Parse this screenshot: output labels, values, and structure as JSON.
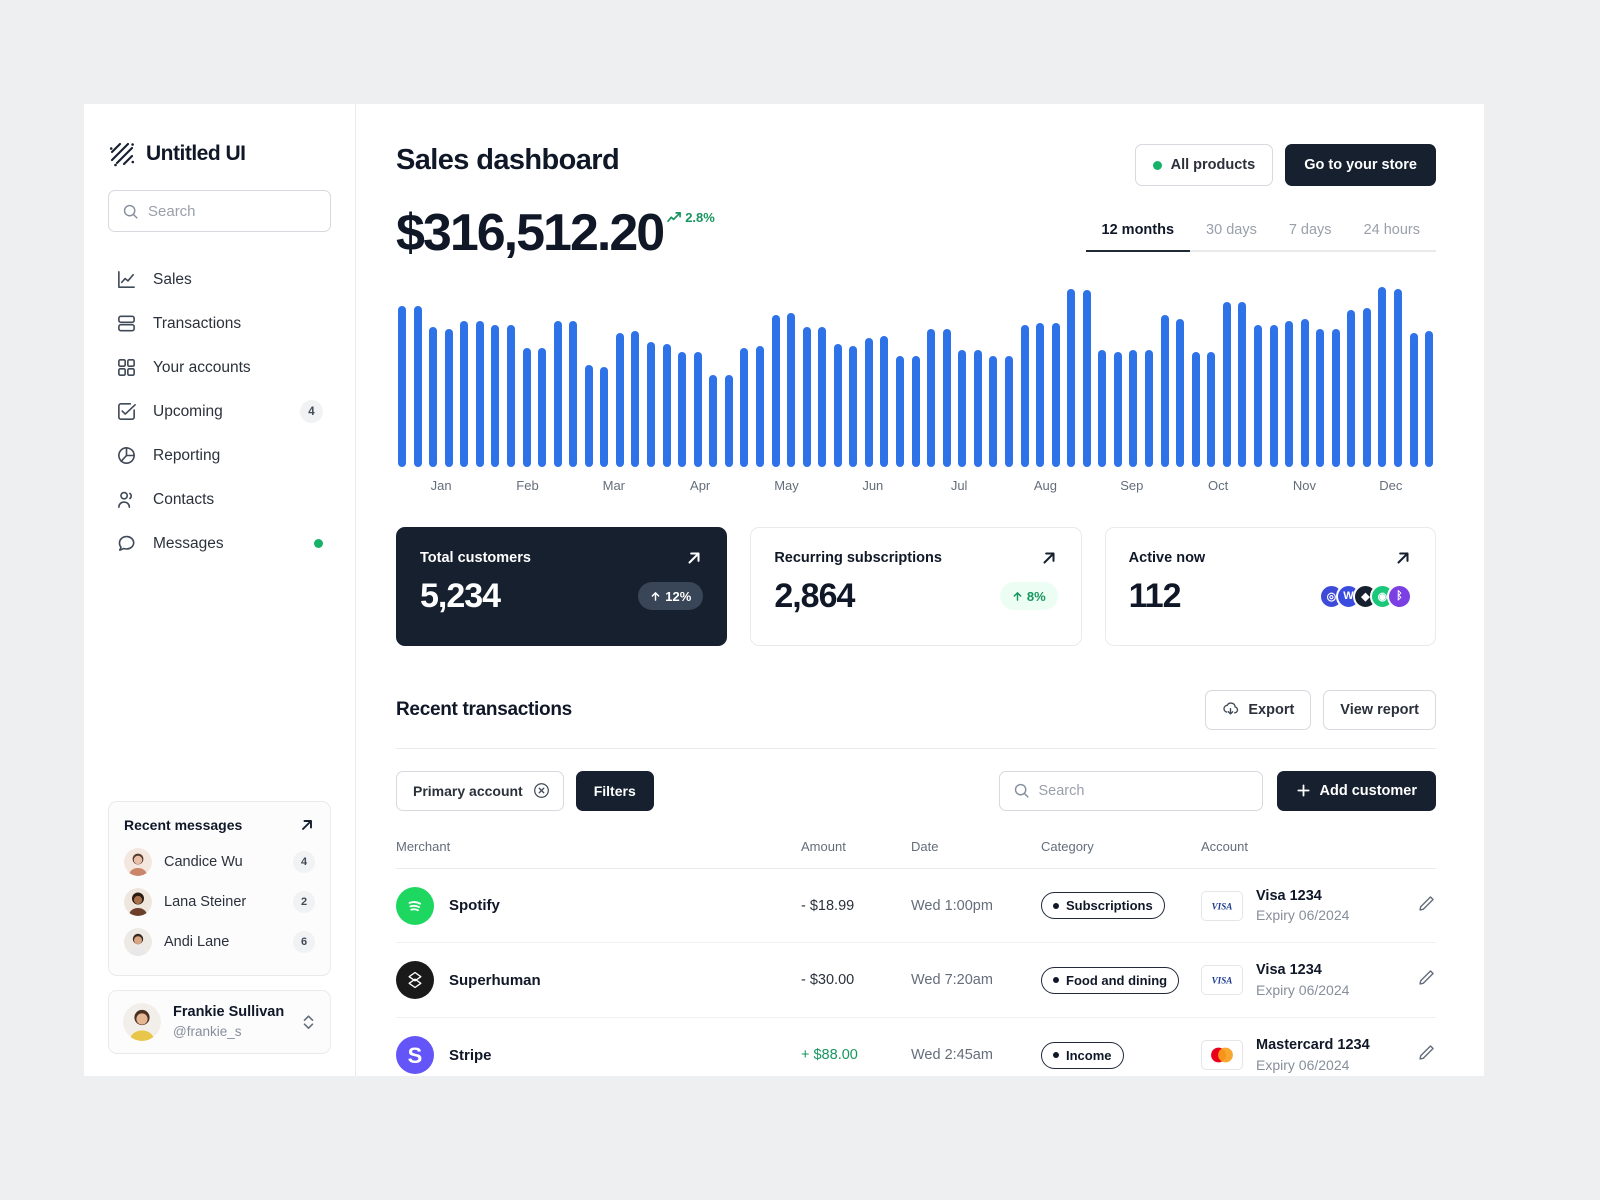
{
  "brand": {
    "name": "Untitled UI",
    "logo_icon": "diagonal-stripes-logo"
  },
  "sidebar": {
    "search": {
      "placeholder": "Search",
      "icon": "search-icon"
    },
    "items": [
      {
        "label": "Sales",
        "icon": "line-chart-icon",
        "badge": "",
        "dot": false
      },
      {
        "label": "Transactions",
        "icon": "rows-icon",
        "badge": "",
        "dot": false
      },
      {
        "label": "Your accounts",
        "icon": "grid-icon",
        "badge": "",
        "dot": false
      },
      {
        "label": "Upcoming",
        "icon": "check-square-icon",
        "badge": "4",
        "dot": false
      },
      {
        "label": "Reporting",
        "icon": "pie-chart-icon",
        "badge": "",
        "dot": false
      },
      {
        "label": "Contacts",
        "icon": "users-icon",
        "badge": "",
        "dot": false
      },
      {
        "label": "Messages",
        "icon": "message-icon",
        "badge": "",
        "dot": true
      }
    ],
    "recent_messages": {
      "title": "Recent messages",
      "expand_icon": "arrow-up-right-icon",
      "people": [
        {
          "name": "Candice Wu",
          "count": "4"
        },
        {
          "name": "Lana Steiner",
          "count": "2"
        },
        {
          "name": "Andi Lane",
          "count": "6"
        }
      ]
    },
    "profile": {
      "name": "Frankie Sullivan",
      "handle": "@frankie_s",
      "switch_icon": "chevron-up-down-icon"
    }
  },
  "header": {
    "title": "Sales dashboard",
    "all_products_label": "All products",
    "all_products_dot_color": "#17B26A",
    "go_to_store_label": "Go to your store"
  },
  "metric": {
    "value": "$316,512.20",
    "trend_value": "2.8%",
    "trend_icon": "trend-up-icon",
    "trend_color": "#17955F"
  },
  "tabs": [
    {
      "label": "12 months",
      "active": true
    },
    {
      "label": "30 days",
      "active": false
    },
    {
      "label": "7 days",
      "active": false
    },
    {
      "label": "24 hours",
      "active": false
    }
  ],
  "chart_data": {
    "type": "bar",
    "title": "",
    "xlabel": "",
    "ylabel": "",
    "grid": false,
    "legend": false,
    "bar_color": "#2E72E8",
    "ylim": [
      0,
      100
    ],
    "categories": [
      "Jan",
      "Feb",
      "Mar",
      "Apr",
      "May",
      "Jun",
      "Jul",
      "Aug",
      "Sep",
      "Oct",
      "Nov",
      "Dec"
    ],
    "x": [
      "Jan-1",
      "Jan-2",
      "Jan-3",
      "Jan-4",
      "Jan-5",
      "Feb-1",
      "Feb-2",
      "Feb-3",
      "Feb-4",
      "Feb-5",
      "Mar-1",
      "Mar-2",
      "Mar-3",
      "Mar-4",
      "Mar-5",
      "Apr-1",
      "Apr-2",
      "Apr-3",
      "Apr-4",
      "Apr-5",
      "May-1",
      "May-2",
      "May-3",
      "May-4",
      "May-5",
      "Jun-1",
      "Jun-2",
      "Jun-3",
      "Jun-4",
      "Jun-5",
      "Jul-1",
      "Jul-2",
      "Jul-3",
      "Jul-4",
      "Jul-5",
      "Aug-1",
      "Aug-2",
      "Aug-3",
      "Aug-4",
      "Aug-5",
      "Sep-1",
      "Sep-2",
      "Sep-3",
      "Sep-4",
      "Sep-5",
      "Oct-1",
      "Oct-2",
      "Oct-3",
      "Oct-4",
      "Oct-5",
      "Nov-1",
      "Nov-2",
      "Nov-3",
      "Nov-4",
      "Nov-5",
      "Dec-1",
      "Dec-2",
      "Dec-3",
      "Dec-4",
      "Dec-5"
    ],
    "values": [
      84,
      84,
      73,
      72,
      76,
      76,
      74,
      74,
      62,
      62,
      76,
      76,
      53,
      52,
      70,
      71,
      65,
      64,
      60,
      60,
      48,
      48,
      62,
      63,
      79,
      80,
      73,
      73,
      64,
      63,
      67,
      68,
      58,
      58,
      72,
      72,
      61,
      61,
      58,
      58,
      74,
      75,
      75,
      93,
      92,
      61,
      60,
      61,
      61,
      79,
      77,
      60,
      60,
      86,
      86,
      74,
      74,
      76,
      77,
      72,
      72,
      82,
      83,
      94,
      93,
      70,
      71
    ]
  },
  "stats": [
    {
      "label": "Total customers",
      "value": "5,234",
      "pill": "12%",
      "pill_icon": "arrow-up-icon",
      "expand_icon": "arrow-up-right-icon",
      "theme": "dark"
    },
    {
      "label": "Recurring subscriptions",
      "value": "2,864",
      "pill": "8%",
      "pill_icon": "arrow-up-icon",
      "expand_icon": "arrow-up-right-icon",
      "theme": "light"
    },
    {
      "label": "Active now",
      "value": "112",
      "pill": "",
      "expand_icon": "arrow-up-right-icon",
      "theme": "light",
      "coins": [
        {
          "name": "solana-coin-icon",
          "color": "#3E4BD8",
          "glyph": "◎"
        },
        {
          "name": "wrapped-coin-icon",
          "color": "#3A4CE0",
          "glyph": "W"
        },
        {
          "name": "ethereum-coin-icon",
          "color": "#16202E",
          "glyph": "◆"
        },
        {
          "name": "green-coin-icon",
          "color": "#19C87A",
          "glyph": "◉"
        },
        {
          "name": "polkadot-coin-icon",
          "color": "#7B3FE4",
          "glyph": "ᛒ"
        }
      ]
    }
  ],
  "transactions_panel": {
    "title": "Recent transactions",
    "export_label": "Export",
    "export_icon": "download-cloud-icon",
    "view_report_label": "View report",
    "filter_chip": "Primary account",
    "filter_chip_icon": "close-circle-icon",
    "filters_label": "Filters",
    "search_placeholder": "Search",
    "search_icon": "search-icon",
    "add_customer_label": "Add customer",
    "add_customer_icon": "plus-icon",
    "columns": [
      "Merchant",
      "Amount",
      "Date",
      "Category",
      "Account",
      ""
    ],
    "rows": [
      {
        "merchant": "Spotify",
        "merchant_icon": "spotify-icon",
        "merchant_color": "#1ED760",
        "amount": "- $18.99",
        "amount_positive": false,
        "date": "Wed 1:00pm",
        "category": "Subscriptions",
        "card_brand": "VISA",
        "account": "Visa 1234",
        "expiry": "Expiry 06/2024",
        "edit_icon": "pencil-icon"
      },
      {
        "merchant": "Superhuman",
        "merchant_icon": "superhuman-icon",
        "merchant_color": "#1A1A1A",
        "amount": "- $30.00",
        "amount_positive": false,
        "date": "Wed 7:20am",
        "category": "Food and dining",
        "card_brand": "VISA",
        "account": "Visa 1234",
        "expiry": "Expiry 06/2024",
        "edit_icon": "pencil-icon"
      },
      {
        "merchant": "Stripe",
        "merchant_icon": "stripe-icon",
        "merchant_color": "#6355F7",
        "amount": "+ $88.00",
        "amount_positive": true,
        "date": "Wed 2:45am",
        "category": "Income",
        "card_brand": "Mastercard",
        "account": "Mastercard 1234",
        "expiry": "Expiry 06/2024",
        "edit_icon": "pencil-icon"
      }
    ]
  }
}
